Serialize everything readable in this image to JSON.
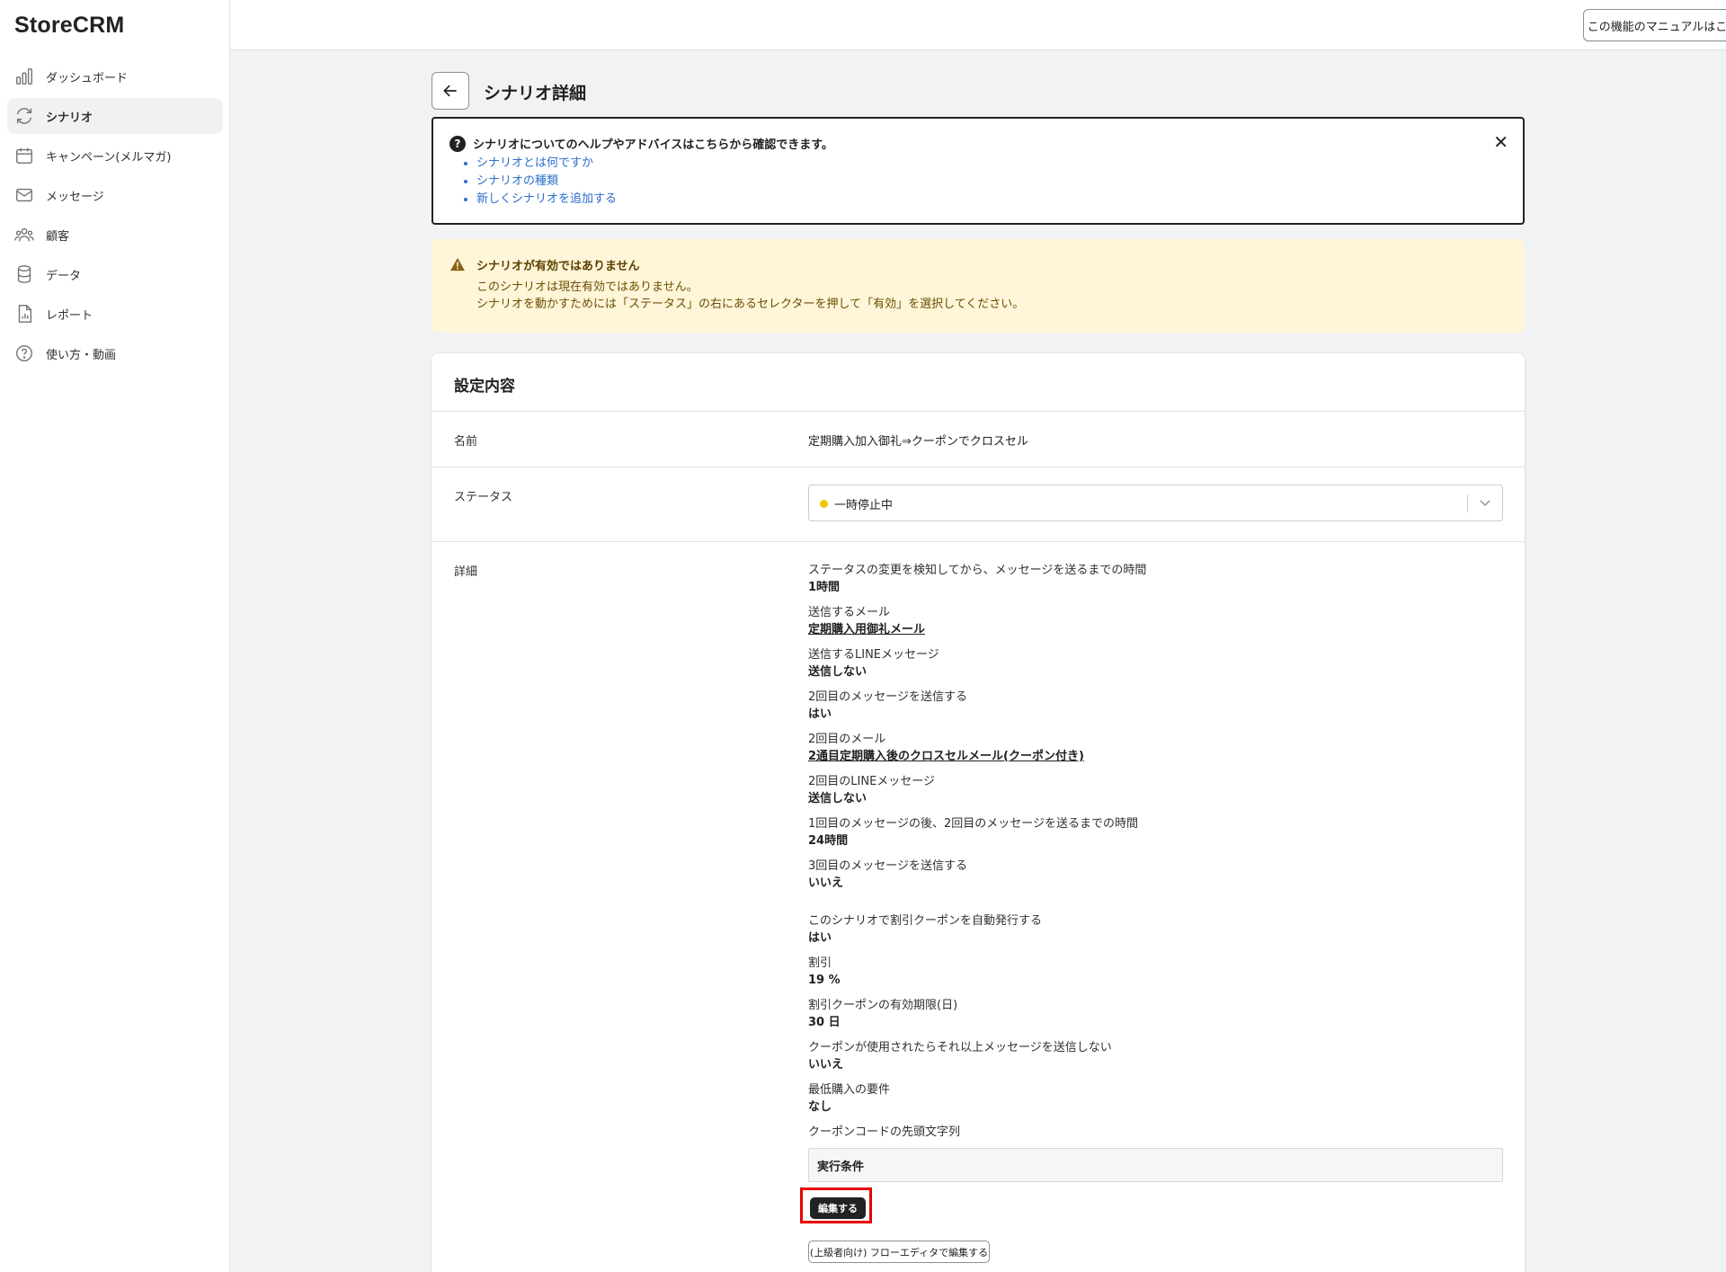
{
  "app": {
    "logo": "StoreCRM"
  },
  "sidebar": {
    "items": [
      {
        "label": "ダッシュボード",
        "icon": "bar-chart-icon",
        "active": false
      },
      {
        "label": "シナリオ",
        "icon": "refresh-icon",
        "active": true
      },
      {
        "label": "キャンペーン(メルマガ)",
        "icon": "calendar-icon",
        "active": false
      },
      {
        "label": "メッセージ",
        "icon": "envelope-icon",
        "active": false
      },
      {
        "label": "顧客",
        "icon": "people-icon",
        "active": false
      },
      {
        "label": "データ",
        "icon": "database-icon",
        "active": false
      },
      {
        "label": "レポート",
        "icon": "report-icon",
        "active": false
      },
      {
        "label": "使い方・動画",
        "icon": "question-icon",
        "active": false
      }
    ]
  },
  "topbar": {
    "manual_label": "この機能のマニュアルはこちら"
  },
  "page": {
    "title": "シナリオ詳細"
  },
  "help": {
    "title": "シナリオについてのヘルプやアドバイスはこちらから確認できます。",
    "links": [
      "シナリオとは何ですか",
      "シナリオの種類",
      "新しくシナリオを追加する"
    ],
    "close": "✕"
  },
  "warning": {
    "title": "シナリオが有効ではありません",
    "line1": "このシナリオは現在有効ではありません。",
    "line2": "シナリオを動かすためには「ステータス」の右にあるセレクターを押して「有効」を選択してください。"
  },
  "settings": {
    "title": "設定内容",
    "name_label": "名前",
    "name_value": "定期購入加入御礼⇒クーポンでクロスセル",
    "status_label": "ステータス",
    "status_value": "一時停止中",
    "status_color": "#f5c400",
    "detail_label": "詳細",
    "details": [
      {
        "label": "ステータスの変更を検知してから、メッセージを送るまでの時間",
        "value": "1時間"
      },
      {
        "label": "送信するメール",
        "value": "定期購入用御礼メール",
        "link": true
      },
      {
        "label": "送信するLINEメッセージ",
        "value": "送信しない"
      },
      {
        "label": "2回目のメッセージを送信する",
        "value": "はい"
      },
      {
        "label": "2回目のメール",
        "value": "2通目定期購入後のクロスセルメール(クーポン付き)",
        "link": true
      },
      {
        "label": "2回目のLINEメッセージ",
        "value": "送信しない"
      },
      {
        "label": "1回目のメッセージの後、2回目のメッセージを送るまでの時間",
        "value": "24時間"
      },
      {
        "label": "3回目のメッセージを送信する",
        "value": "いいえ"
      }
    ],
    "details2": [
      {
        "label": "このシナリオで割引クーポンを自動発行する",
        "value": "はい"
      },
      {
        "label": "割引",
        "value": "19 %"
      },
      {
        "label": "割引クーポンの有効期限(日)",
        "value": "30 日"
      },
      {
        "label": "クーポンが使用されたらそれ以上メッセージを送信しない",
        "value": "いいえ"
      },
      {
        "label": "最低購入の要件",
        "value": "なし"
      }
    ],
    "prefix_label": "クーポンコードの先頭文字列",
    "condition_title": "実行条件",
    "edit_label": "編集する",
    "flow_edit_label": "(上級者向け) フローエディタで編集する"
  }
}
